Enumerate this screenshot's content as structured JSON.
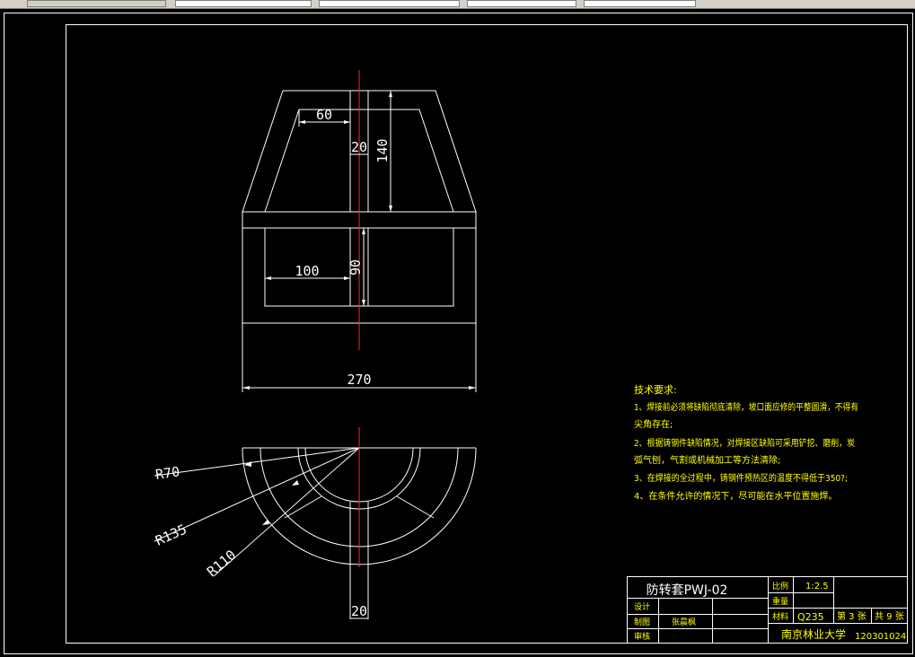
{
  "colors": {
    "background": "#000000",
    "line": "#ffffff",
    "centerline": "#ff2a2a",
    "note_text": "#ffff00"
  },
  "toolbar": {
    "cells": [
      "",
      "",
      "",
      "",
      ""
    ]
  },
  "dimensions": {
    "top_width": "60",
    "slot_width": "20",
    "height": "140",
    "inner_width": "100",
    "inner_height": "90",
    "overall_width": "270",
    "radius_outer": "R135",
    "radius_mid": "R110",
    "radius_inner": "R70",
    "bottom_slot": "20"
  },
  "notes": {
    "title": "技术要求:",
    "lines": [
      "1、焊接前必须将缺陷彻底清除，坡口面应修的平整圆滑，不得有",
      "尖角存在;",
      "2、根据铸钢件缺陷情况，对焊接区缺陷可采用铲挖、磨削，炭",
      "弧气刨，气割或机械加工等方法清除;",
      "3、在焊接的全过程中，铸钢件预热区的温度不得低于350?;",
      "4、在条件允许的情况下，尽可能在水平位置施焊。"
    ]
  },
  "title_block": {
    "part_name": "防转套PWJ-02",
    "design_label": "设计",
    "drawn_label": "制图",
    "drawn_name": "张晨枫",
    "review_label": "审核",
    "scale_label": "比例",
    "scale_value": "1:2.5",
    "weight_label": "重量",
    "material_label": "材料",
    "material_value": "Q235",
    "sheet_label": "第 3 张",
    "total_label": "共 9 张",
    "school": "南京林业大学",
    "student_id": "120301024"
  }
}
